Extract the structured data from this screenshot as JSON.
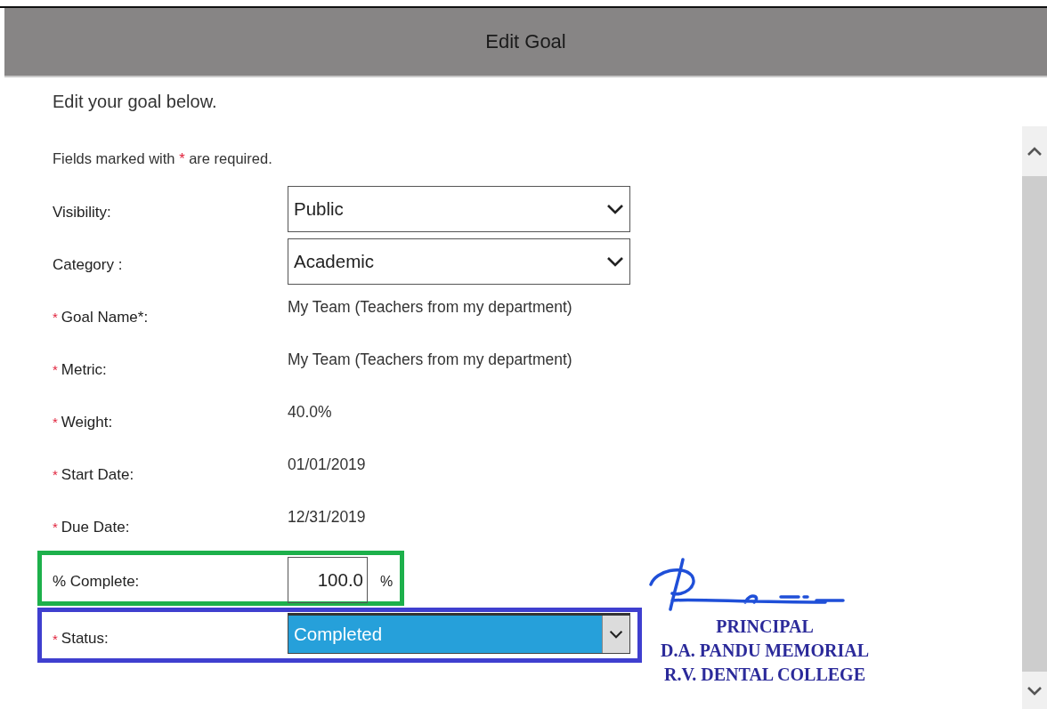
{
  "dialog": {
    "title": "Edit Goal"
  },
  "intro": "Edit your goal below.",
  "required_note": {
    "before": "Fields marked with",
    "mark": "*",
    "after": "are required."
  },
  "fields": [
    {
      "kind": "select",
      "label": "Visibility:",
      "required": false,
      "value": "Public"
    },
    {
      "kind": "select",
      "label": "Category :",
      "required": false,
      "value": "Academic"
    },
    {
      "kind": "text",
      "label": "Goal Name*:",
      "required": true,
      "value": "My Team (Teachers from my department)"
    },
    {
      "kind": "text",
      "label": "Metric:",
      "required": true,
      "value": "My Team (Teachers from my department)"
    },
    {
      "kind": "text",
      "label": "Weight:",
      "required": true,
      "value": "40.0%"
    },
    {
      "kind": "text",
      "label": "Start Date:",
      "required": true,
      "value": "01/01/2019"
    },
    {
      "kind": "text",
      "label": "Due Date:",
      "required": true,
      "value": "12/31/2019"
    },
    {
      "kind": "percent",
      "label": "% Complete:",
      "required": false,
      "value": "100.0",
      "unit": "%",
      "color": "#1db04b"
    },
    {
      "kind": "select",
      "label": "Status:",
      "required": true,
      "value": "Completed",
      "focused": true,
      "color": "#3f3fcf"
    }
  ],
  "stamp": {
    "lines": [
      "PRINCIPAL",
      "D.A. PANDU MEMORIAL",
      "R.V. DENTAL COLLEGE"
    ]
  }
}
